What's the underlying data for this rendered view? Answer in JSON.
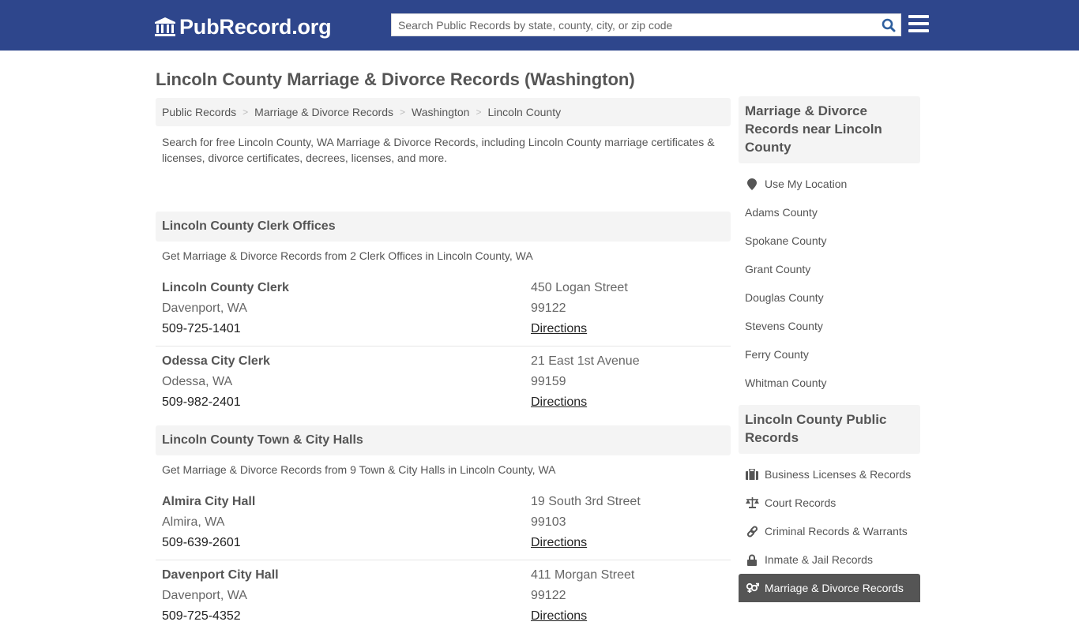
{
  "header": {
    "logo_text": "PubRecord.org",
    "search_placeholder": "Search Public Records by state, county, city, or zip code",
    "brand_color": "#2e468c"
  },
  "page_title": "Lincoln County Marriage & Divorce Records (Washington)",
  "breadcrumb": [
    "Public Records",
    "Marriage & Divorce Records",
    "Washington",
    "Lincoln County"
  ],
  "intro": "Search for free Lincoln County, WA Marriage & Divorce Records, including Lincoln County marriage certificates & licenses, divorce certificates, decrees, licenses, and more.",
  "sections": [
    {
      "title": "Lincoln County Clerk Offices",
      "subtitle": "Get Marriage & Divorce Records from 2 Clerk Offices in Lincoln County, WA",
      "entries": [
        {
          "name": "Lincoln County Clerk",
          "city": "Davenport, WA",
          "phone": "509-725-1401",
          "address": "450 Logan Street",
          "zip": "99122",
          "directions": "Directions"
        },
        {
          "name": "Odessa City Clerk",
          "city": "Odessa, WA",
          "phone": "509-982-2401",
          "address": "21 East 1st Avenue",
          "zip": "99159",
          "directions": "Directions"
        }
      ]
    },
    {
      "title": "Lincoln County Town & City Halls",
      "subtitle": "Get Marriage & Divorce Records from 9 Town & City Halls in Lincoln County, WA",
      "entries": [
        {
          "name": "Almira City Hall",
          "city": "Almira, WA",
          "phone": "509-639-2601",
          "address": "19 South 3rd Street",
          "zip": "99103",
          "directions": "Directions"
        },
        {
          "name": "Davenport City Hall",
          "city": "Davenport, WA",
          "phone": "509-725-4352",
          "address": "411 Morgan Street",
          "zip": "99122",
          "directions": "Directions"
        }
      ]
    }
  ],
  "sidebar": {
    "nearby_title": "Marriage & Divorce Records near Lincoln County",
    "use_location": "Use My Location",
    "nearby": [
      "Adams County",
      "Spokane County",
      "Grant County",
      "Douglas County",
      "Stevens County",
      "Ferry County",
      "Whitman County"
    ],
    "public_title": "Lincoln County Public Records",
    "public_records": [
      {
        "label": "Business Licenses & Records",
        "icon": "briefcase-icon"
      },
      {
        "label": "Court Records",
        "icon": "scales-icon"
      },
      {
        "label": "Criminal Records & Warrants",
        "icon": "link-icon"
      },
      {
        "label": "Inmate & Jail Records",
        "icon": "lock-icon"
      },
      {
        "label": "Marriage & Divorce Records",
        "icon": "gender-icon",
        "active": true
      }
    ]
  }
}
